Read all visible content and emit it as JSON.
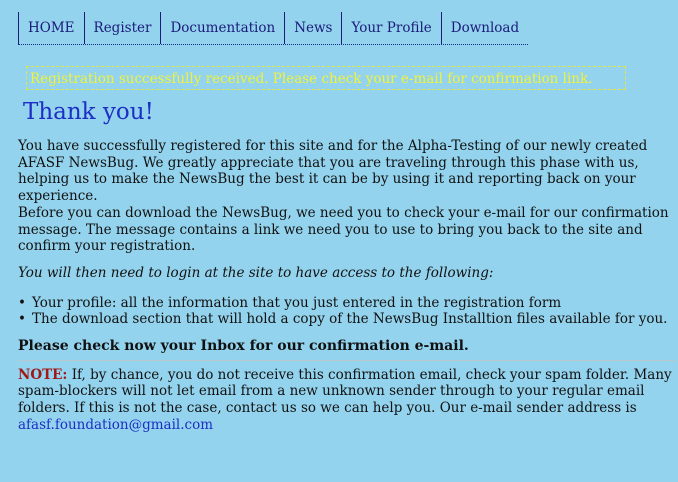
{
  "nav": {
    "items": [
      {
        "label": "HOME"
      },
      {
        "label": "Register"
      },
      {
        "label": "Documentation"
      },
      {
        "label": "News"
      },
      {
        "label": "Your Profile"
      },
      {
        "label": "Download"
      }
    ]
  },
  "notice": "Registration successfully received. Please check your e-mail for confirmation link.",
  "title": "Thank you!",
  "paragraphs": [
    "You have successfully registered for this site and for the Alpha-Testing of our newly created AFASF NewsBug. We greatly appreciate that you are traveling through this phase with us, helping us to make the NewsBug the best it can be by using it and reporting back on your experience.",
    "Before you can download the NewsBug, we need you to check your e-mail for our confirmation message. The message contains a link we need you to use to bring you back to the site and confirm your registration."
  ],
  "italic_line": "You will then need to login at the site to have access to the following:",
  "list": [
    "Your profile: all the information that you just entered in the registration form",
    "The download section that will hold a copy of the NewsBug Installtion files available for you."
  ],
  "inbox_line": "Please check now your Inbox for our confirmation e-mail.",
  "note": {
    "label": "NOTE:",
    "lines": [
      " If, by chance, you do not receive this confirmation email, check your spam folder. Many",
      "spam-blockers will not let email from a new unknown sender through to your regular email",
      "folders. If this is not the case, contact us so we can help you. Our e-mail sender address is"
    ],
    "email": "afasf.foundation@gmail.com"
  },
  "colors": {
    "background": "#93d3ed",
    "nav_text": "#1b1b7a",
    "notice_text": "#f2f23a",
    "title": "#1d2ec4",
    "note_label": "#a01818"
  }
}
